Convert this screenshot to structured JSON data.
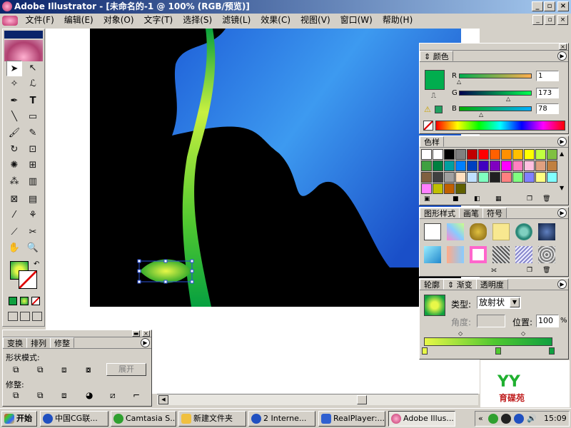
{
  "titlebar": {
    "title": "Adobe Illustrator - [未命名的-1 @ 100% (RGB/预览)]"
  },
  "menu": [
    "文件(F)",
    "编辑(E)",
    "对象(O)",
    "文字(T)",
    "选择(S)",
    "滤镜(L)",
    "效果(C)",
    "视图(V)",
    "窗口(W)",
    "帮助(H)"
  ],
  "color_panel": {
    "tab": "颜色",
    "r_label": "R",
    "g_label": "G",
    "b_label": "B",
    "r": "1",
    "g": "173",
    "b": "78",
    "current_color": "#01ad4e"
  },
  "swatch_panel": {
    "tab": "色样"
  },
  "style_panel": {
    "tabs": [
      "图形样式",
      "画笔",
      "符号"
    ]
  },
  "gradient_panel": {
    "tabs": [
      "轮廓",
      "渐变",
      "透明度"
    ],
    "type_label": "类型:",
    "type_value": "放射状",
    "angle_label": "角度:",
    "location_label": "位置:",
    "location_value": "100",
    "percent": "%"
  },
  "pathfinder_panel": {
    "tabs": [
      "变换",
      "排列",
      "修整"
    ],
    "shape_mode_label": "形状模式:",
    "expand_label": "展开",
    "pathfinder_label": "修整:"
  },
  "logo": {
    "text": "育碟苑"
  },
  "taskbar": {
    "start": "开始",
    "items": [
      "中国CG联...",
      "Camtasia S...",
      "新建文件夹",
      "2 Interne...",
      "RealPlayer:...",
      "Adobe Illus..."
    ],
    "clock": "15:09"
  }
}
